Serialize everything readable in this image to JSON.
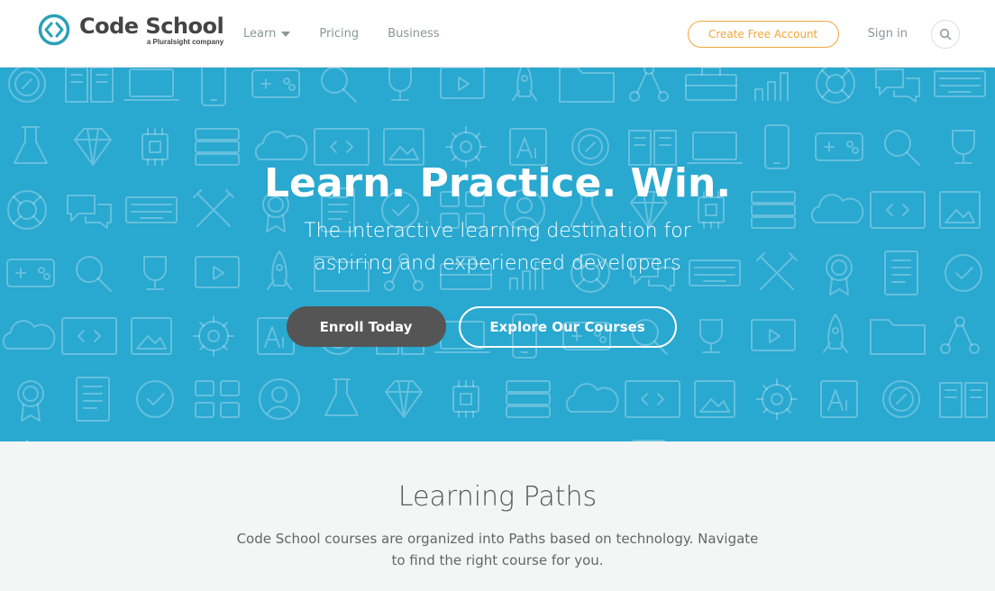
{
  "header": {
    "brand_name": "Code School",
    "brand_tagline": "a Pluralsight company",
    "nav": [
      {
        "label": "Learn",
        "has_dropdown": true
      },
      {
        "label": "Pricing"
      },
      {
        "label": "Business"
      }
    ],
    "create_account_label": "Create Free Account",
    "signin_label": "Sign in",
    "search_icon": "search-icon"
  },
  "hero": {
    "title": "Learn. Practice. Win.",
    "subtitle_line1": "The interactive learning destination for",
    "subtitle_line2": "aspiring and experienced developers",
    "enroll_label": "Enroll Today",
    "explore_label": "Explore Our Courses",
    "background_pattern_icons": [
      "compass-icon",
      "book-icon",
      "laptop-icon",
      "phone-icon",
      "gamepad-icon",
      "magnifier-icon",
      "trophy-icon",
      "video-icon",
      "rocket-icon",
      "folder-icon",
      "network-icon",
      "toolbox-icon",
      "bar-chart-icon",
      "lifebuoy-icon",
      "chat-icon",
      "keyboard-icon",
      "tools-icon",
      "ribbon-icon",
      "document-icon",
      "check-circle-icon",
      "grid-icon",
      "user-icon",
      "flask-icon",
      "gem-icon",
      "chip-icon",
      "server-icon",
      "cloud-icon",
      "code-icon",
      "image-icon",
      "gear-icon",
      "font-icon"
    ]
  },
  "learning_paths": {
    "title": "Learning Paths",
    "desc_line1": "Code School courses are organized into Paths based on technology. Navigate",
    "desc_line2": "to find the right course for you."
  },
  "colors": {
    "hero_bg": "#29a8d0",
    "accent_orange": "#f2a638",
    "logo_teal": "#2aa1b4",
    "enroll_bg": "#555555"
  }
}
